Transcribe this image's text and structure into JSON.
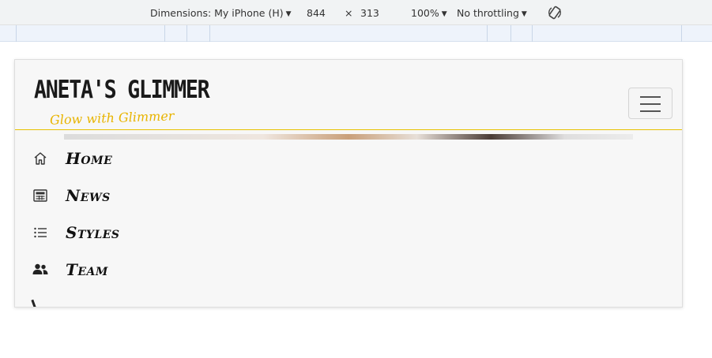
{
  "devtools": {
    "dimensions_label": "Dimensions: My iPhone (H)",
    "width_value": "844",
    "times_sign": "×",
    "height_value": "313",
    "zoom": "100%",
    "throttling": "No throttling"
  },
  "site": {
    "brand_title": "ANETA'S GLIMMER",
    "brand_tagline": "Glow with Glimmer",
    "accent_color": "#e8b400"
  },
  "nav": {
    "items": [
      {
        "label": "Home",
        "icon": "home-icon"
      },
      {
        "label": "News",
        "icon": "newspaper-icon"
      },
      {
        "label": "Styles",
        "icon": "list-icon"
      },
      {
        "label": "Team",
        "icon": "people-icon"
      }
    ]
  }
}
